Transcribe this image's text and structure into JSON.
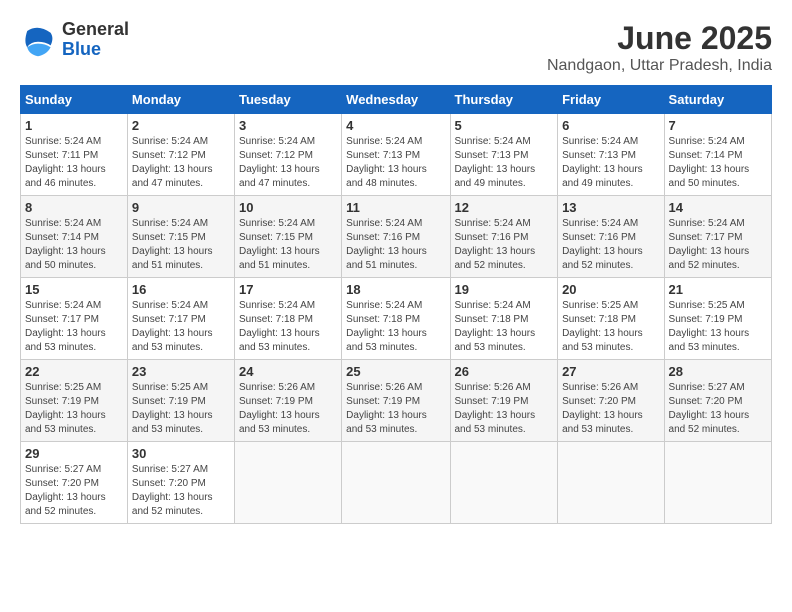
{
  "logo": {
    "text_general": "General",
    "text_blue": "Blue"
  },
  "title": "June 2025",
  "subtitle": "Nandgaon, Uttar Pradesh, India",
  "weekdays": [
    "Sunday",
    "Monday",
    "Tuesday",
    "Wednesday",
    "Thursday",
    "Friday",
    "Saturday"
  ],
  "weeks": [
    [
      {
        "day": "1",
        "info": "Sunrise: 5:24 AM\nSunset: 7:11 PM\nDaylight: 13 hours\nand 46 minutes."
      },
      {
        "day": "2",
        "info": "Sunrise: 5:24 AM\nSunset: 7:12 PM\nDaylight: 13 hours\nand 47 minutes."
      },
      {
        "day": "3",
        "info": "Sunrise: 5:24 AM\nSunset: 7:12 PM\nDaylight: 13 hours\nand 47 minutes."
      },
      {
        "day": "4",
        "info": "Sunrise: 5:24 AM\nSunset: 7:13 PM\nDaylight: 13 hours\nand 48 minutes."
      },
      {
        "day": "5",
        "info": "Sunrise: 5:24 AM\nSunset: 7:13 PM\nDaylight: 13 hours\nand 49 minutes."
      },
      {
        "day": "6",
        "info": "Sunrise: 5:24 AM\nSunset: 7:13 PM\nDaylight: 13 hours\nand 49 minutes."
      },
      {
        "day": "7",
        "info": "Sunrise: 5:24 AM\nSunset: 7:14 PM\nDaylight: 13 hours\nand 50 minutes."
      }
    ],
    [
      {
        "day": "8",
        "info": "Sunrise: 5:24 AM\nSunset: 7:14 PM\nDaylight: 13 hours\nand 50 minutes."
      },
      {
        "day": "9",
        "info": "Sunrise: 5:24 AM\nSunset: 7:15 PM\nDaylight: 13 hours\nand 51 minutes."
      },
      {
        "day": "10",
        "info": "Sunrise: 5:24 AM\nSunset: 7:15 PM\nDaylight: 13 hours\nand 51 minutes."
      },
      {
        "day": "11",
        "info": "Sunrise: 5:24 AM\nSunset: 7:16 PM\nDaylight: 13 hours\nand 51 minutes."
      },
      {
        "day": "12",
        "info": "Sunrise: 5:24 AM\nSunset: 7:16 PM\nDaylight: 13 hours\nand 52 minutes."
      },
      {
        "day": "13",
        "info": "Sunrise: 5:24 AM\nSunset: 7:16 PM\nDaylight: 13 hours\nand 52 minutes."
      },
      {
        "day": "14",
        "info": "Sunrise: 5:24 AM\nSunset: 7:17 PM\nDaylight: 13 hours\nand 52 minutes."
      }
    ],
    [
      {
        "day": "15",
        "info": "Sunrise: 5:24 AM\nSunset: 7:17 PM\nDaylight: 13 hours\nand 53 minutes."
      },
      {
        "day": "16",
        "info": "Sunrise: 5:24 AM\nSunset: 7:17 PM\nDaylight: 13 hours\nand 53 minutes."
      },
      {
        "day": "17",
        "info": "Sunrise: 5:24 AM\nSunset: 7:18 PM\nDaylight: 13 hours\nand 53 minutes."
      },
      {
        "day": "18",
        "info": "Sunrise: 5:24 AM\nSunset: 7:18 PM\nDaylight: 13 hours\nand 53 minutes."
      },
      {
        "day": "19",
        "info": "Sunrise: 5:24 AM\nSunset: 7:18 PM\nDaylight: 13 hours\nand 53 minutes."
      },
      {
        "day": "20",
        "info": "Sunrise: 5:25 AM\nSunset: 7:18 PM\nDaylight: 13 hours\nand 53 minutes."
      },
      {
        "day": "21",
        "info": "Sunrise: 5:25 AM\nSunset: 7:19 PM\nDaylight: 13 hours\nand 53 minutes."
      }
    ],
    [
      {
        "day": "22",
        "info": "Sunrise: 5:25 AM\nSunset: 7:19 PM\nDaylight: 13 hours\nand 53 minutes."
      },
      {
        "day": "23",
        "info": "Sunrise: 5:25 AM\nSunset: 7:19 PM\nDaylight: 13 hours\nand 53 minutes."
      },
      {
        "day": "24",
        "info": "Sunrise: 5:26 AM\nSunset: 7:19 PM\nDaylight: 13 hours\nand 53 minutes."
      },
      {
        "day": "25",
        "info": "Sunrise: 5:26 AM\nSunset: 7:19 PM\nDaylight: 13 hours\nand 53 minutes."
      },
      {
        "day": "26",
        "info": "Sunrise: 5:26 AM\nSunset: 7:19 PM\nDaylight: 13 hours\nand 53 minutes."
      },
      {
        "day": "27",
        "info": "Sunrise: 5:26 AM\nSunset: 7:20 PM\nDaylight: 13 hours\nand 53 minutes."
      },
      {
        "day": "28",
        "info": "Sunrise: 5:27 AM\nSunset: 7:20 PM\nDaylight: 13 hours\nand 52 minutes."
      }
    ],
    [
      {
        "day": "29",
        "info": "Sunrise: 5:27 AM\nSunset: 7:20 PM\nDaylight: 13 hours\nand 52 minutes."
      },
      {
        "day": "30",
        "info": "Sunrise: 5:27 AM\nSunset: 7:20 PM\nDaylight: 13 hours\nand 52 minutes."
      },
      {
        "day": "",
        "info": ""
      },
      {
        "day": "",
        "info": ""
      },
      {
        "day": "",
        "info": ""
      },
      {
        "day": "",
        "info": ""
      },
      {
        "day": "",
        "info": ""
      }
    ]
  ]
}
